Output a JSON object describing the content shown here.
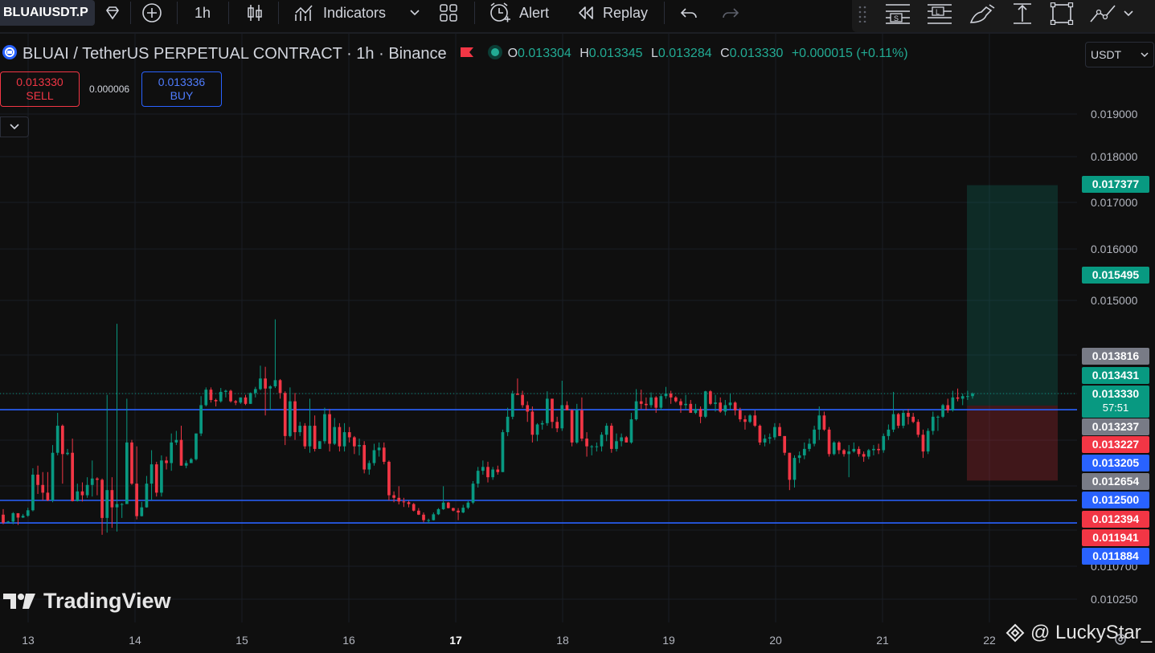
{
  "toolbar": {
    "symbol": "BLUAIUSDT.P",
    "interval": "1h",
    "indicators_label": "Indicators",
    "alert_label": "Alert",
    "replay_label": "Replay"
  },
  "legend": {
    "title": "BLUAI / TetherUS PERPETUAL CONTRACT · 1h · Binance",
    "o_label": "O",
    "o_value": "0.013304",
    "h_label": "H",
    "h_value": "0.013345",
    "l_label": "L",
    "l_value": "0.013284",
    "c_label": "C",
    "c_value": "0.013330",
    "change": "+0.000015 (+0.11%)"
  },
  "trade": {
    "sell_price": "0.013330",
    "sell_label": "SELL",
    "spread": "0.000006",
    "buy_price": "0.013336",
    "buy_label": "BUY"
  },
  "currency": "USDT",
  "price_axis": [
    "0.019000",
    "0.018000",
    "0.017000",
    "0.016000",
    "0.015000",
    "0.010700",
    "0.010250"
  ],
  "badges": [
    {
      "text": "0.017377",
      "color": "#089981"
    },
    {
      "text": "0.015495",
      "color": "#089981"
    },
    {
      "text": "0.013816",
      "color": "#787b86"
    },
    {
      "text": "0.013431",
      "color": "#089981"
    },
    {
      "text": "0.013330",
      "countdown": "57:51",
      "color": "#089981"
    },
    {
      "text": "0.013237",
      "color": "#787b86"
    },
    {
      "text": "0.013227",
      "color": "#f23645"
    },
    {
      "text": "0.013205",
      "color": "#2962ff"
    },
    {
      "text": "0.012654",
      "color": "#787b86"
    },
    {
      "text": "0.012500",
      "color": "#2962ff"
    },
    {
      "text": "0.012394",
      "color": "#f23645"
    },
    {
      "text": "0.011941",
      "color": "#f23645"
    },
    {
      "text": "0.011884",
      "color": "#2962ff"
    }
  ],
  "dates": [
    "13",
    "14",
    "15",
    "16",
    "17",
    "18",
    "19",
    "20",
    "21",
    "22"
  ],
  "logo_text": "TradingView",
  "watermark": "@ LuckyStar_",
  "colors": {
    "up": "#089981",
    "down": "#f23645",
    "line": "#2962ff",
    "background": "#0f0f0f"
  },
  "chart_data": {
    "type": "candlestick",
    "x": [
      "13",
      "14",
      "15",
      "16",
      "17",
      "18",
      "19",
      "20",
      "21",
      "22"
    ],
    "horizontal_lines": [
      0.013205,
      0.0125,
      0.011884
    ],
    "position": {
      "target": 0.017377,
      "entry": 0.013237,
      "stop": 0.012654
    },
    "ohlc": [
      [
        0.01211,
        0.01226,
        0.01185,
        0.01189
      ],
      [
        0.01192,
        0.01194,
        0.01188,
        0.01192
      ],
      [
        0.01192,
        0.01218,
        0.01185,
        0.01215
      ],
      [
        0.01215,
        0.01215,
        0.01183,
        0.01203
      ],
      [
        0.01203,
        0.01213,
        0.01202,
        0.01208
      ],
      [
        0.01208,
        0.0123,
        0.01205,
        0.01223
      ],
      [
        0.01223,
        0.01275,
        0.0122,
        0.0127
      ],
      [
        0.0127,
        0.01277,
        0.01255,
        0.01262
      ],
      [
        0.01262,
        0.01272,
        0.0125,
        0.01256
      ],
      [
        0.01256,
        0.01272,
        0.01248,
        0.0125
      ],
      [
        0.0125,
        0.01293,
        0.01245,
        0.01287
      ],
      [
        0.01287,
        0.01318,
        0.01285,
        0.01308
      ],
      [
        0.01308,
        0.01309,
        0.01263,
        0.01286
      ],
      [
        0.01286,
        0.0129,
        0.01285,
        0.01287
      ],
      [
        0.01287,
        0.01298,
        0.01247,
        0.01248
      ],
      [
        0.01248,
        0.01263,
        0.01247,
        0.01257
      ],
      [
        0.01257,
        0.01264,
        0.01247,
        0.01254
      ],
      [
        0.01254,
        0.01268,
        0.01252,
        0.01262
      ],
      [
        0.01262,
        0.01281,
        0.01253,
        0.01267
      ],
      [
        0.01267,
        0.01268,
        0.01254,
        0.01266
      ],
      [
        0.01266,
        0.01267,
        0.01156,
        0.01202
      ],
      [
        0.01202,
        0.01332,
        0.01162,
        0.01258
      ],
      [
        0.01258,
        0.01268,
        0.01175,
        0.01231
      ],
      [
        0.01231,
        0.01458,
        0.01165,
        0.0124
      ],
      [
        0.0124,
        0.01243,
        0.01202,
        0.0124
      ],
      [
        0.0124,
        0.01329,
        0.0124,
        0.01295
      ],
      [
        0.01295,
        0.01297,
        0.01262,
        0.01263
      ],
      [
        0.01263,
        0.01292,
        0.01198,
        0.01207
      ],
      [
        0.01207,
        0.01246,
        0.01206,
        0.01231
      ],
      [
        0.01231,
        0.01269,
        0.0123,
        0.01263
      ],
      [
        0.01263,
        0.01289,
        0.0125,
        0.01278
      ],
      [
        0.01278,
        0.0128,
        0.01253,
        0.01256
      ],
      [
        0.01256,
        0.01285,
        0.01253,
        0.01281
      ],
      [
        0.01281,
        0.01284,
        0.01274,
        0.01279
      ],
      [
        0.01279,
        0.01302,
        0.01273,
        0.01295
      ],
      [
        0.01295,
        0.01304,
        0.01293,
        0.01297
      ],
      [
        0.01297,
        0.01308,
        0.01277,
        0.01277
      ],
      [
        0.01277,
        0.01281,
        0.01275,
        0.01279
      ],
      [
        0.01279,
        0.01283,
        0.0128,
        0.01282
      ],
      [
        0.01282,
        0.01302,
        0.01281,
        0.01302
      ],
      [
        0.01302,
        0.01331,
        0.013,
        0.01324
      ],
      [
        0.01324,
        0.01344,
        0.01323,
        0.0134
      ],
      [
        0.0134,
        0.01344,
        0.01326,
        0.01328
      ],
      [
        0.01328,
        0.01329,
        0.01323,
        0.01327
      ],
      [
        0.01327,
        0.01343,
        0.01326,
        0.01336
      ],
      [
        0.01336,
        0.0134,
        0.0133,
        0.01338
      ],
      [
        0.01338,
        0.0134,
        0.01326,
        0.01327
      ],
      [
        0.01327,
        0.01328,
        0.01324,
        0.01326
      ],
      [
        0.01326,
        0.0133,
        0.01325,
        0.0133
      ],
      [
        0.0133,
        0.01332,
        0.01324,
        0.01325
      ],
      [
        0.01325,
        0.01335,
        0.01325,
        0.01334
      ],
      [
        0.01334,
        0.01345,
        0.0133,
        0.01341
      ],
      [
        0.01341,
        0.01383,
        0.01339,
        0.0136
      ],
      [
        0.0136,
        0.01381,
        0.01316,
        0.01342
      ],
      [
        0.01342,
        0.01348,
        0.0132,
        0.01346
      ],
      [
        0.01346,
        0.01466,
        0.01343,
        0.01357
      ],
      [
        0.01357,
        0.01359,
        0.01329,
        0.01334
      ],
      [
        0.01334,
        0.01337,
        0.01293,
        0.013
      ],
      [
        0.013,
        0.01344,
        0.01299,
        0.01327
      ],
      [
        0.01327,
        0.01334,
        0.01297,
        0.01303
      ],
      [
        0.01303,
        0.01311,
        0.013,
        0.01308
      ],
      [
        0.01308,
        0.0131,
        0.0129,
        0.01292
      ],
      [
        0.01292,
        0.01329,
        0.01287,
        0.01308
      ],
      [
        0.01308,
        0.01316,
        0.01288,
        0.0129
      ],
      [
        0.0129,
        0.01296,
        0.01291,
        0.01296
      ],
      [
        0.01296,
        0.01322,
        0.01294,
        0.01317
      ],
      [
        0.01317,
        0.01321,
        0.01288,
        0.01294
      ],
      [
        0.01294,
        0.01314,
        0.01293,
        0.01307
      ],
      [
        0.01307,
        0.0131,
        0.01288,
        0.01292
      ],
      [
        0.01292,
        0.0131,
        0.01288,
        0.01303
      ],
      [
        0.01303,
        0.01307,
        0.01295,
        0.01299
      ],
      [
        0.01299,
        0.013,
        0.01286,
        0.01292
      ],
      [
        0.01292,
        0.01298,
        0.01285,
        0.01293
      ],
      [
        0.01293,
        0.01296,
        0.01271,
        0.01274
      ],
      [
        0.01274,
        0.01281,
        0.0127,
        0.01279
      ],
      [
        0.01279,
        0.01294,
        0.01277,
        0.01289
      ],
      [
        0.01289,
        0.01295,
        0.01284,
        0.01291
      ],
      [
        0.01291,
        0.01295,
        0.01278,
        0.0128
      ],
      [
        0.0128,
        0.01281,
        0.0125,
        0.01254
      ],
      [
        0.01254,
        0.01257,
        0.01245,
        0.01252
      ],
      [
        0.01252,
        0.01261,
        0.01239,
        0.01247
      ],
      [
        0.01247,
        0.01252,
        0.01232,
        0.01245
      ],
      [
        0.01245,
        0.01249,
        0.01231,
        0.0124
      ],
      [
        0.0124,
        0.01243,
        0.0122,
        0.01222
      ],
      [
        0.01222,
        0.01229,
        0.0121,
        0.01211
      ],
      [
        0.01211,
        0.01217,
        0.0119,
        0.01196
      ],
      [
        0.01196,
        0.012,
        0.01188,
        0.01196
      ],
      [
        0.01196,
        0.01217,
        0.01195,
        0.01212
      ],
      [
        0.01212,
        0.01229,
        0.0121,
        0.01226
      ],
      [
        0.01226,
        0.01261,
        0.01224,
        0.01244
      ],
      [
        0.01244,
        0.01246,
        0.01228,
        0.01229
      ],
      [
        0.01229,
        0.0123,
        0.0122,
        0.01222
      ],
      [
        0.01222,
        0.01229,
        0.01196,
        0.01217
      ],
      [
        0.01217,
        0.01238,
        0.01215,
        0.0123
      ],
      [
        0.0123,
        0.01248,
        0.01226,
        0.01244
      ],
      [
        0.01244,
        0.01265,
        0.0124,
        0.01263
      ],
      [
        0.01263,
        0.01276,
        0.0126,
        0.01273
      ],
      [
        0.01273,
        0.01281,
        0.0127,
        0.01276
      ],
      [
        0.01276,
        0.0128,
        0.01264,
        0.01268
      ],
      [
        0.01268,
        0.01276,
        0.01266,
        0.01274
      ],
      [
        0.01274,
        0.01277,
        0.0127,
        0.01272
      ],
      [
        0.01272,
        0.01305,
        0.01272,
        0.01303
      ],
      [
        0.01303,
        0.01322,
        0.013,
        0.01315
      ],
      [
        0.01315,
        0.01338,
        0.01313,
        0.01333
      ],
      [
        0.01333,
        0.0136,
        0.01332,
        0.01332
      ],
      [
        0.01332,
        0.01338,
        0.01322,
        0.01324
      ],
      [
        0.01324,
        0.01327,
        0.01311,
        0.01319
      ],
      [
        0.01319,
        0.01323,
        0.01295,
        0.01301
      ],
      [
        0.01301,
        0.0131,
        0.01296,
        0.01309
      ],
      [
        0.01309,
        0.01312,
        0.01305,
        0.0131
      ],
      [
        0.0131,
        0.01337,
        0.01308,
        0.01329
      ],
      [
        0.01329,
        0.01329,
        0.01306,
        0.01311
      ],
      [
        0.01311,
        0.01315,
        0.01303,
        0.01306
      ],
      [
        0.01306,
        0.01356,
        0.01304,
        0.01324
      ],
      [
        0.01324,
        0.01327,
        0.0132,
        0.0132
      ],
      [
        0.0132,
        0.01321,
        0.01292,
        0.01295
      ],
      [
        0.01295,
        0.01325,
        0.01294,
        0.0132
      ],
      [
        0.0132,
        0.0133,
        0.01296,
        0.01298
      ],
      [
        0.01298,
        0.01303,
        0.01284,
        0.01292
      ],
      [
        0.01292,
        0.01293,
        0.01285,
        0.01292
      ],
      [
        0.01292,
        0.01295,
        0.01288,
        0.01292
      ],
      [
        0.01292,
        0.01303,
        0.01288,
        0.01301
      ],
      [
        0.01301,
        0.0131,
        0.01296,
        0.01308
      ],
      [
        0.01308,
        0.0131,
        0.01287,
        0.0129
      ],
      [
        0.0129,
        0.01302,
        0.01288,
        0.01296
      ],
      [
        0.01296,
        0.01302,
        0.01292,
        0.01299
      ],
      [
        0.01299,
        0.013,
        0.01295,
        0.01295
      ],
      [
        0.01295,
        0.01318,
        0.01294,
        0.01313
      ],
      [
        0.01313,
        0.01341,
        0.01312,
        0.01327
      ],
      [
        0.01327,
        0.0134,
        0.01321,
        0.01325
      ],
      [
        0.01325,
        0.0133,
        0.0132,
        0.01324
      ],
      [
        0.01324,
        0.01335,
        0.01322,
        0.0133
      ],
      [
        0.0133,
        0.01331,
        0.01318,
        0.01322
      ],
      [
        0.01322,
        0.01333,
        0.0132,
        0.01331
      ],
      [
        0.01331,
        0.01345,
        0.01329,
        0.01333
      ],
      [
        0.01333,
        0.01338,
        0.01325,
        0.0133
      ],
      [
        0.0133,
        0.01331,
        0.01326,
        0.01327
      ],
      [
        0.01327,
        0.01329,
        0.01318,
        0.01324
      ],
      [
        0.01324,
        0.01332,
        0.01321,
        0.01325
      ],
      [
        0.01325,
        0.01328,
        0.01318,
        0.01318
      ],
      [
        0.01318,
        0.01325,
        0.01317,
        0.01321
      ],
      [
        0.01321,
        0.01323,
        0.0131,
        0.01315
      ],
      [
        0.01315,
        0.01338,
        0.01314,
        0.01337
      ],
      [
        0.01337,
        0.01339,
        0.01324,
        0.01325
      ],
      [
        0.01325,
        0.01332,
        0.01319,
        0.01326
      ],
      [
        0.01326,
        0.0133,
        0.01318,
        0.01319
      ],
      [
        0.01319,
        0.01328,
        0.01316,
        0.01324
      ],
      [
        0.01324,
        0.01333,
        0.01321,
        0.01326
      ],
      [
        0.01326,
        0.01327,
        0.01316,
        0.0132
      ],
      [
        0.0132,
        0.01322,
        0.01311,
        0.01313
      ],
      [
        0.01313,
        0.01316,
        0.01305,
        0.01311
      ],
      [
        0.01311,
        0.01317,
        0.0131,
        0.01316
      ],
      [
        0.01316,
        0.0132,
        0.01307,
        0.01308
      ],
      [
        0.01308,
        0.01309,
        0.01293,
        0.01295
      ],
      [
        0.01295,
        0.01301,
        0.01292,
        0.01298
      ],
      [
        0.01298,
        0.01302,
        0.01294,
        0.01299
      ],
      [
        0.01299,
        0.0131,
        0.01297,
        0.01307
      ],
      [
        0.01307,
        0.0131,
        0.013,
        0.013
      ],
      [
        0.013,
        0.013,
        0.01285,
        0.01287
      ],
      [
        0.01287,
        0.01287,
        0.01258,
        0.01266
      ],
      [
        0.01266,
        0.01285,
        0.0126,
        0.01283
      ],
      [
        0.01283,
        0.01288,
        0.01279,
        0.01285
      ],
      [
        0.01285,
        0.01295,
        0.01282,
        0.0129
      ],
      [
        0.0129,
        0.01298,
        0.01288,
        0.01294
      ],
      [
        0.01294,
        0.01308,
        0.01292,
        0.01305
      ],
      [
        0.01305,
        0.01323,
        0.01297,
        0.01316
      ],
      [
        0.01316,
        0.01319,
        0.01304,
        0.01305
      ],
      [
        0.01305,
        0.01307,
        0.01284,
        0.01286
      ],
      [
        0.01286,
        0.01296,
        0.01285,
        0.01295
      ],
      [
        0.01295,
        0.01296,
        0.01286,
        0.01289
      ],
      [
        0.01289,
        0.0129,
        0.01284,
        0.01286
      ],
      [
        0.01286,
        0.01293,
        0.01268,
        0.01288
      ],
      [
        0.01288,
        0.01295,
        0.01287,
        0.0129
      ],
      [
        0.0129,
        0.01292,
        0.01284,
        0.01286
      ],
      [
        0.01286,
        0.01288,
        0.0128,
        0.01284
      ],
      [
        0.01284,
        0.0129,
        0.01282,
        0.01289
      ],
      [
        0.01289,
        0.01293,
        0.01285,
        0.0129
      ],
      [
        0.0129,
        0.01294,
        0.01286,
        0.01289
      ],
      [
        0.01289,
        0.01302,
        0.01287,
        0.013
      ],
      [
        0.013,
        0.01309,
        0.01297,
        0.01305
      ],
      [
        0.01305,
        0.01336,
        0.01303,
        0.01317
      ],
      [
        0.01317,
        0.01318,
        0.01306,
        0.01308
      ],
      [
        0.01308,
        0.0132,
        0.01306,
        0.01318
      ],
      [
        0.01318,
        0.01321,
        0.01309,
        0.01315
      ],
      [
        0.01315,
        0.01318,
        0.0131,
        0.01311
      ],
      [
        0.01311,
        0.01313,
        0.01299,
        0.01301
      ],
      [
        0.01301,
        0.01305,
        0.01283,
        0.01288
      ],
      [
        0.01288,
        0.01306,
        0.01286,
        0.01304
      ],
      [
        0.01304,
        0.01319,
        0.01301,
        0.01315
      ],
      [
        0.01315,
        0.01316,
        0.01304,
        0.01315
      ],
      [
        0.01315,
        0.01325,
        0.01314,
        0.01324
      ],
      [
        0.01324,
        0.01329,
        0.01318,
        0.0132
      ],
      [
        0.0132,
        0.01338,
        0.01319,
        0.0133
      ],
      [
        0.0133,
        0.01342,
        0.01327,
        0.01329
      ],
      [
        0.01329,
        0.01333,
        0.01324,
        0.01331
      ],
      [
        0.01331,
        0.01338,
        0.01328,
        0.01331
      ],
      [
        0.01331,
        0.01335,
        0.01329,
        0.01333
      ]
    ]
  }
}
